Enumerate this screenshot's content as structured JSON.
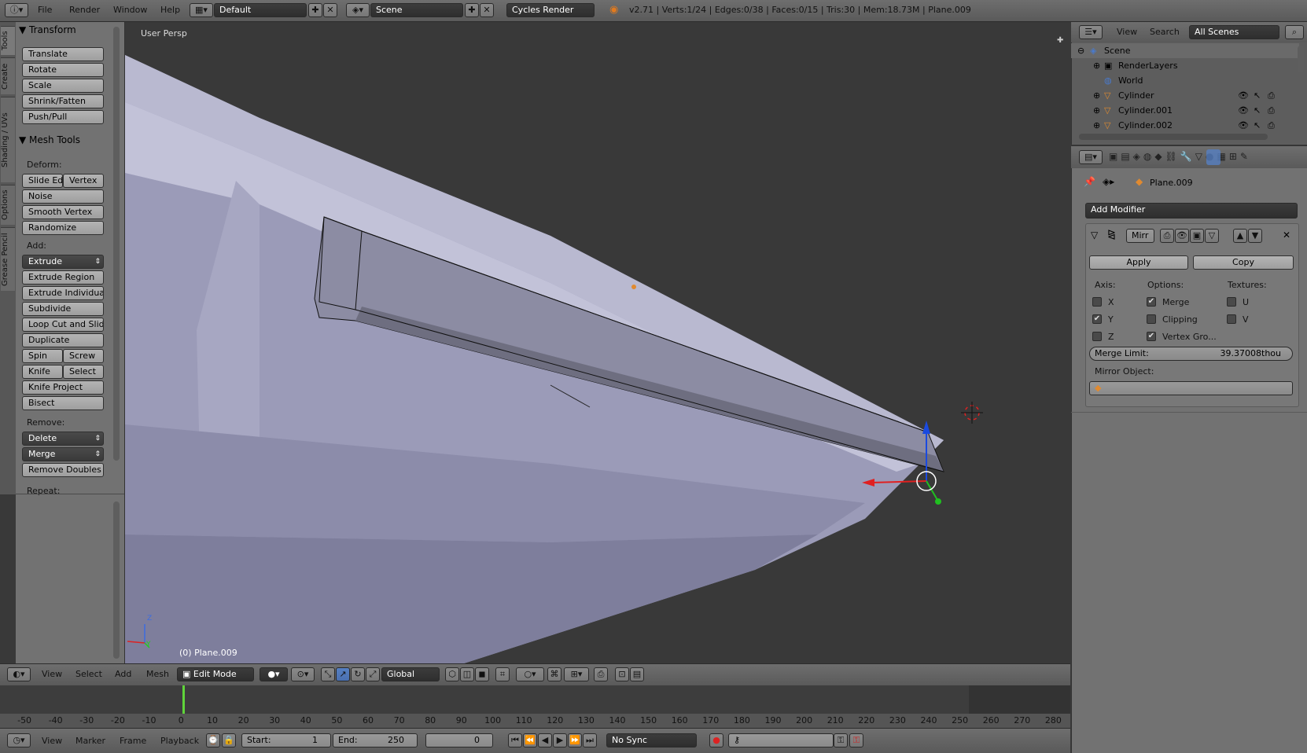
{
  "topbar": {
    "menus": [
      "File",
      "Render",
      "Window",
      "Help"
    ],
    "screen_layout": "Default",
    "scene": "Scene",
    "render_engine": "Cycles Render",
    "stats": "v2.71 | Verts:1/24 | Edges:0/38 | Faces:0/15 | Tris:30 | Mem:18.73M | Plane.009"
  },
  "tabstrip": [
    "Tools",
    "Create",
    "Shading / UVs",
    "Options",
    "Grease Pencil"
  ],
  "toolshelf": {
    "transform_title": "Transform",
    "transform_buttons": [
      "Translate",
      "Rotate",
      "Scale",
      "Shrink/Fatten",
      "Push/Pull"
    ],
    "mesh_tools_title": "Mesh Tools",
    "deform_label": "Deform:",
    "slide_edge": "Slide Ed",
    "vertex": "Vertex",
    "noise": "Noise",
    "smooth_vertex": "Smooth Vertex",
    "randomize": "Randomize",
    "add_label": "Add:",
    "extrude": "Extrude",
    "extrude_region": "Extrude Region",
    "extrude_individual": "Extrude Individual",
    "subdivide": "Subdivide",
    "loop_cut": "Loop Cut and Slide",
    "duplicate": "Duplicate",
    "spin": "Spin",
    "screw": "Screw",
    "knife": "Knife",
    "select": "Select",
    "knife_project": "Knife Project",
    "bisect": "Bisect",
    "remove_label": "Remove:",
    "delete": "Delete",
    "merge": "Merge",
    "remove_doubles": "Remove Doubles",
    "repeat_label": "Repeat:"
  },
  "viewport": {
    "view_label": "User Persp",
    "object_label": "(0) Plane.009",
    "axis_z": "Z",
    "axis_y": "Y"
  },
  "view3d_header": {
    "menus": [
      "View",
      "Select",
      "Add",
      "Mesh"
    ],
    "mode": "Edit Mode",
    "orientation": "Global"
  },
  "timeline": {
    "ticks": [
      "-50",
      "-40",
      "-30",
      "-20",
      "-10",
      "0",
      "10",
      "20",
      "30",
      "40",
      "50",
      "60",
      "70",
      "80",
      "90",
      "100",
      "110",
      "120",
      "130",
      "140",
      "150",
      "160",
      "170",
      "180",
      "190",
      "200",
      "210",
      "220",
      "230",
      "240",
      "250",
      "260",
      "270",
      "280"
    ],
    "current_frame_marker": 0
  },
  "timeline_header": {
    "menus": [
      "View",
      "Marker",
      "Frame",
      "Playback"
    ],
    "start_label": "Start:",
    "start_value": "1",
    "end_label": "End:",
    "end_value": "250",
    "current_frame": "0",
    "sync": "No Sync"
  },
  "outliner": {
    "menus": [
      "View",
      "Search"
    ],
    "filter": "All Scenes",
    "rows": [
      "Scene",
      "RenderLayers",
      "World",
      "Cylinder",
      "Cylinder.001",
      "Cylinder.002"
    ]
  },
  "properties": {
    "object_name": "Plane.009",
    "add_modifier": "Add Modifier",
    "modifier_name": "Mirr",
    "apply": "Apply",
    "copy": "Copy",
    "axis_label": "Axis:",
    "options_label": "Options:",
    "textures_label": "Textures:",
    "axis_x": "X",
    "axis_y": "Y",
    "axis_z": "Z",
    "merge": "Merge",
    "clipping": "Clipping",
    "vertex_groups": "Vertex Gro...",
    "tex_u": "U",
    "tex_v": "V",
    "merge_limit_label": "Merge Limit:",
    "merge_limit_value": "39.37008thou",
    "mirror_object_label": "Mirror Object:",
    "checks": {
      "x": false,
      "y": true,
      "z": false,
      "merge": true,
      "clipping": false,
      "vertex_groups": true,
      "u": false,
      "v": false
    }
  },
  "colors": {
    "accent_blue": "#5680c2",
    "frame_marker": "#5fd43a",
    "mesh_face": "#a0a0bc"
  }
}
